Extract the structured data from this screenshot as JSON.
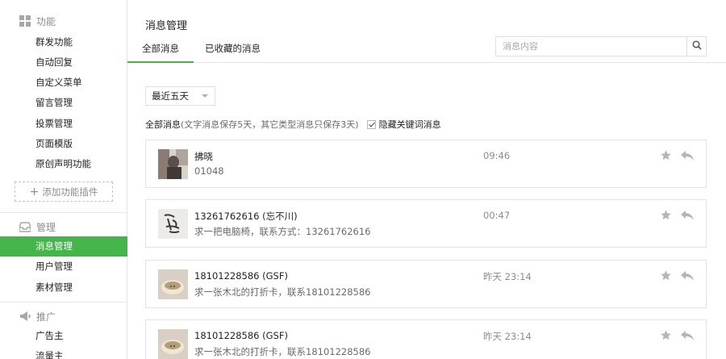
{
  "sidebar": {
    "sections": [
      {
        "label": "功能",
        "icon": "grid-icon"
      },
      {
        "label": "管理",
        "icon": "inbox-icon"
      },
      {
        "label": "推广",
        "icon": "megaphone-icon"
      }
    ],
    "function_items": [
      "群发功能",
      "自动回复",
      "自定义菜单",
      "留言管理",
      "投票管理",
      "页面模版",
      "原创声明功能"
    ],
    "add_plugin": "添加功能插件",
    "manage_items": [
      "消息管理",
      "用户管理",
      "素材管理"
    ],
    "promote_items": [
      "广告主",
      "流量主"
    ],
    "active_item": "消息管理"
  },
  "main": {
    "title": "消息管理",
    "tabs": [
      "全部消息",
      "已收藏的消息"
    ],
    "active_tab": "全部消息",
    "search": {
      "placeholder": "消息内容",
      "value": ""
    },
    "filter": {
      "selected": "最近五天"
    },
    "note_main": "全部消息",
    "note_sub": "(文字消息保存5天，其它类型消息只保存3天)",
    "hide_keywords": {
      "label": "隐藏关键词消息",
      "checked": true
    }
  },
  "messages": [
    {
      "name": "拂晓",
      "content": "01048",
      "time": "09:46"
    },
    {
      "name": "13261762616 (忘不川)",
      "content": "求一把电脑椅，联系方式：13261762616",
      "time": "00:47"
    },
    {
      "name": "18101228586 (GSF)",
      "content": "求一张木北的打折卡，联系18101228586",
      "time": "昨天 23:14"
    },
    {
      "name": "18101228586 (GSF)",
      "content": "求一张木北的打折卡，联系18101228586",
      "time": "昨天 23:14"
    }
  ],
  "colors": {
    "accent": "#44b549",
    "muted": "#8d8d8d",
    "border": "#e4e4e4"
  }
}
